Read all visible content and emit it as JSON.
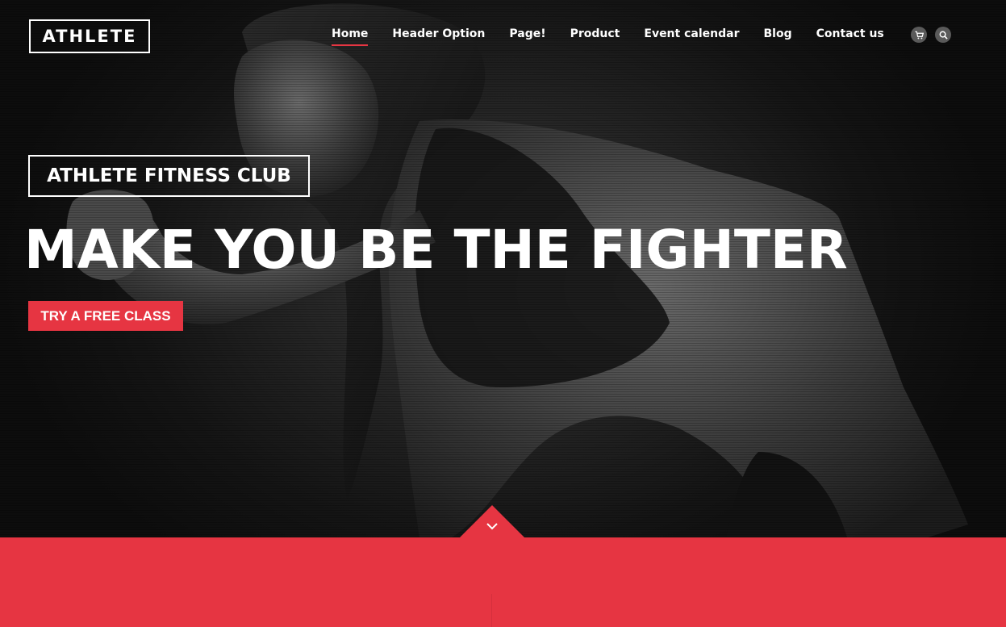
{
  "header": {
    "logo": "ATHLETE",
    "nav": [
      {
        "label": "Home",
        "active": true
      },
      {
        "label": "Header Option",
        "active": false
      },
      {
        "label": "Page!",
        "active": false
      },
      {
        "label": "Product",
        "active": false
      },
      {
        "label": "Event calendar",
        "active": false
      },
      {
        "label": "Blog",
        "active": false
      },
      {
        "label": "Contact us",
        "active": false
      }
    ],
    "tools": [
      {
        "icon": "cart-icon"
      },
      {
        "icon": "search-icon"
      }
    ]
  },
  "hero": {
    "club_label": "ATHLETE FITNESS CLUB",
    "headline": "MAKE YOU BE THE FIGHTER",
    "cta_label": "TRY A FREE CLASS",
    "scroll_icon": "chevron-down-icon"
  },
  "colors": {
    "accent": "#e63542",
    "background": "#111111",
    "text": "#ffffff"
  }
}
